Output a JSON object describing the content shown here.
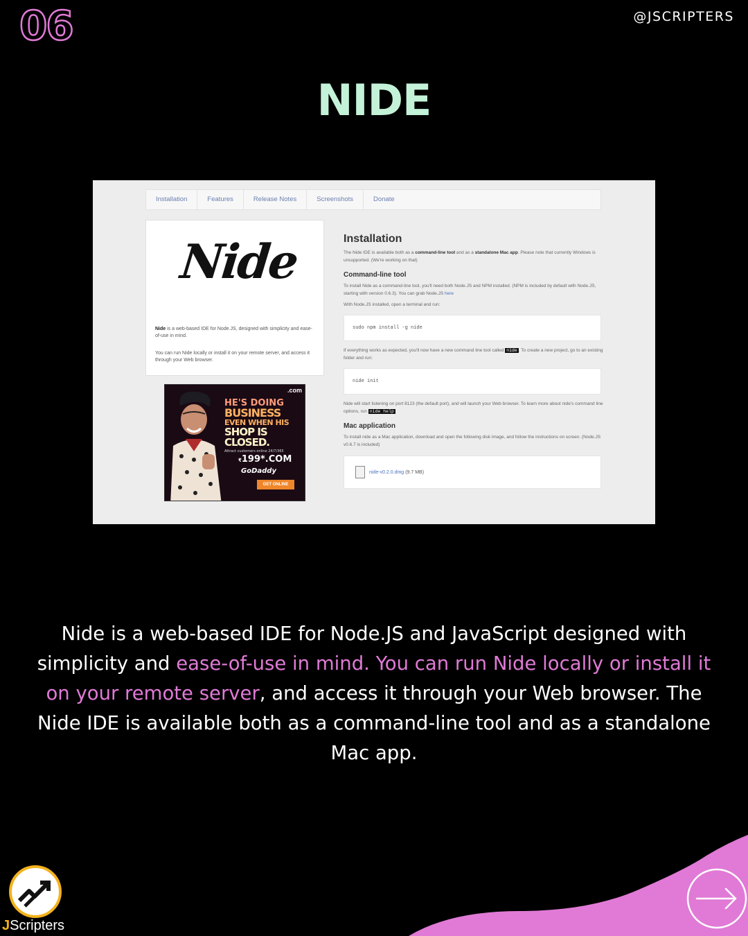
{
  "header": {
    "slide_number": "06",
    "handle": "@JSCRIPTERS",
    "title": "NIDE"
  },
  "screenshot": {
    "nav_tabs": [
      "Installation",
      "Features",
      "Release Notes",
      "Screenshots",
      "Donate"
    ],
    "logo_text": "Nide",
    "left_intro_bold": "Nide",
    "left_intro": " is a web-based IDE for Node.JS, designed with simplicity and ease-of-use in mind.",
    "left_intro2": "You can run Nide locally or install it on your remote server, and access it through your Web browser.",
    "ad": {
      "dotcom": ".com",
      "line1": "HE'S DOING",
      "line2": "BUSINESS",
      "line3": "EVEN WHEN HIS",
      "line4": "SHOP IS CLOSED.",
      "small": "Attract customers online 24/7/365",
      "price": "199*.COM",
      "price_prefix": "₹",
      "brand": "GoDaddy",
      "cta": "GET ONLINE"
    },
    "install_heading": "Installation",
    "install_p1": "The Nide IDE is available both as a ",
    "install_p1_b1": "command-line tool",
    "install_p1_mid": " and as a ",
    "install_p1_b2": "standalone Mac app",
    "install_p1_end": ". Please note that currently Windows is unsupported. (We're working on that)",
    "cli_heading": "Command-line tool",
    "cli_p1": "To install Nide as a command-line tool, you'll need both Node.JS and NPM installed. (NPM is included by default with Node.JS, starting with version 0.6.3). You can grab Node.JS ",
    "cli_p1_link": "here",
    "cli_p2": "With Node.JS installed, open a terminal and run:",
    "cli_code1": "sudo npm install -g nide",
    "cli_p3": "If everything works as expected, you'll now have a new command line tool called ",
    "cli_p3_kbd": "nide",
    "cli_p3_end": ". To create a new project, go to an existing folder and run:",
    "cli_code2": "nide init",
    "cli_p4": "Nide will start listening on port 8123 (the default port), and will launch your Web browser. To learn more about nide's command line options, run ",
    "cli_p4_kbd": "nide help",
    "mac_heading": "Mac application",
    "mac_p1": "To install nide as a Mac application, download and open the following disk image, and follow the instructions on screen. (Node.JS v0.6.7 is included)",
    "mac_file": "nide-v0.2.0.dmg",
    "mac_file_size": "(9.7 MB)"
  },
  "description": {
    "part1": "Nide is a web-based IDE for Node.JS and JavaScript designed with simplicity and ",
    "highlight": "ease-of-use in mind. You can run Nide locally or install it on your remote server",
    "part2": ", and access it through your Web browser. The Nide IDE is available both as a command-line tool and as a standalone Mac app."
  },
  "footer": {
    "brand_j": "J",
    "brand_rest": "Scripters",
    "next_icon": "arrow-right-icon"
  },
  "colors": {
    "accent_pink": "#e07ad6",
    "title_mint": "#c4f2d9",
    "brand_gold": "#f3b21c",
    "background": "#000000"
  }
}
